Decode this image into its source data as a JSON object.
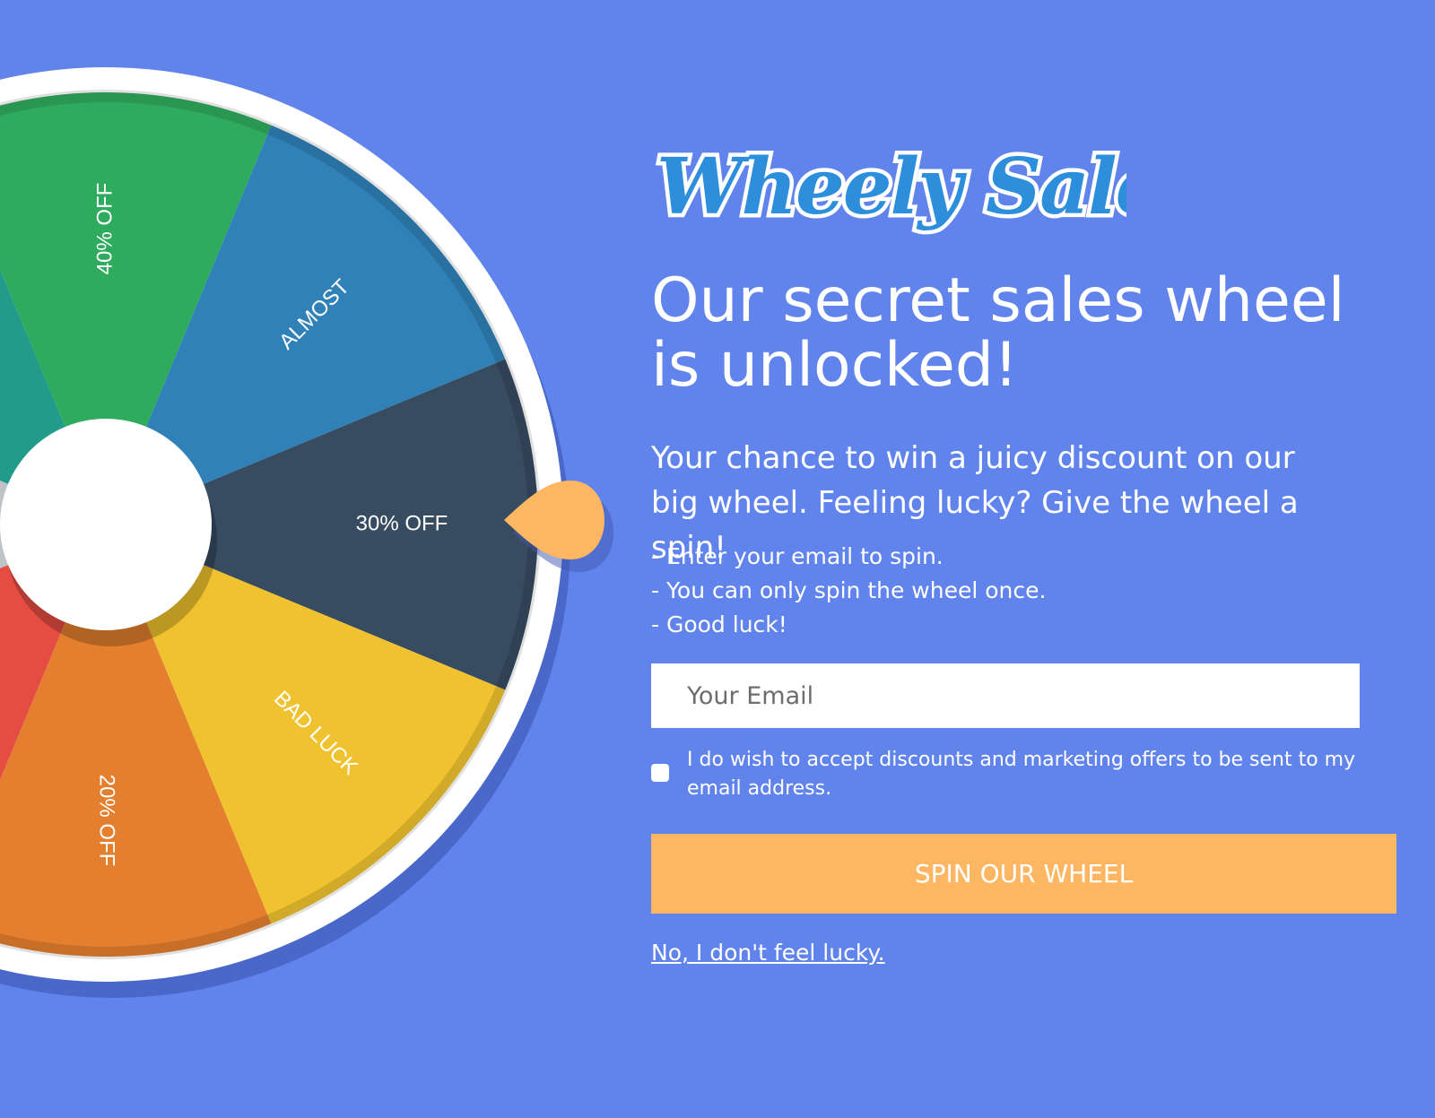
{
  "brand": {
    "logo_text": "Wheely Sales",
    "colors": {
      "background": "#6184ec",
      "button": "#fdb662",
      "pointer": "#fdb662",
      "logo_fill": "#2d8fdc"
    }
  },
  "wheel": {
    "segments": [
      {
        "label": "",
        "color": "#229b8a"
      },
      {
        "label": "40% OFF",
        "color": "#2fab5e"
      },
      {
        "label": "ALMOST",
        "color": "#2f81b8"
      },
      {
        "label": "30% OFF",
        "color": "#374b61"
      },
      {
        "label": "BAD LUCK",
        "color": "#f0c22f"
      },
      {
        "label": "20% OFF",
        "color": "#e37f2f"
      },
      {
        "label": "",
        "color": "#e54d43"
      },
      {
        "label": "",
        "color": "#bdc3c7"
      }
    ],
    "pointer_icon": "teardrop-pointer-icon"
  },
  "content": {
    "headline": "Our secret sales wheel is unlocked!",
    "subheading": "Your chance to win a juicy discount on our big wheel. Feeling lucky? Give the wheel a spin!",
    "rules": [
      "- Enter your email to spin.",
      "- You can only spin the wheel once.",
      "- Good luck!"
    ]
  },
  "form": {
    "email_placeholder": "Your Email",
    "email_value": "",
    "consent_text": "I do wish to accept discounts and marketing offers to be sent to my email address.",
    "consent_checked": false,
    "spin_label": "SPIN OUR WHEEL",
    "decline_label": "No, I don't feel lucky."
  }
}
